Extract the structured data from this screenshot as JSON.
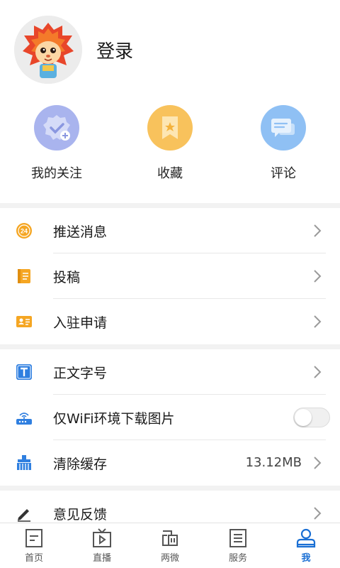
{
  "profile": {
    "login_label": "登录"
  },
  "quick_actions": [
    {
      "label": "我的关注",
      "icon": "follow-badge-icon",
      "color": "#a9b4ee"
    },
    {
      "label": "收藏",
      "icon": "bookmark-icon",
      "color": "#f8c25c"
    },
    {
      "label": "评论",
      "icon": "comment-icon",
      "color": "#8fc0f4"
    }
  ],
  "menu_group1": [
    {
      "label": "推送消息",
      "icon": "push-24h-icon"
    },
    {
      "label": "投稿",
      "icon": "document-icon"
    },
    {
      "label": "入驻申请",
      "icon": "id-card-icon"
    }
  ],
  "menu_group2": [
    {
      "label": "正文字号",
      "icon": "text-size-icon"
    },
    {
      "label": "仅WiFi环境下载图片",
      "icon": "wifi-router-icon",
      "toggle_on": false
    },
    {
      "label": "清除缓存",
      "icon": "broom-icon",
      "value": "13.12MB"
    }
  ],
  "menu_group3": [
    {
      "label": "意见反馈",
      "icon": "pencil-icon"
    }
  ],
  "tabbar": {
    "items": [
      {
        "label": "首页",
        "icon": "home-doc-icon"
      },
      {
        "label": "直播",
        "icon": "tv-play-icon"
      },
      {
        "label": "两微",
        "icon": "two-micro-icon"
      },
      {
        "label": "服务",
        "icon": "list-icon"
      },
      {
        "label": "我",
        "icon": "user-icon"
      }
    ],
    "active_index": 4
  },
  "colors": {
    "accent": "#1a6fd4",
    "orange": "#f5a623"
  }
}
